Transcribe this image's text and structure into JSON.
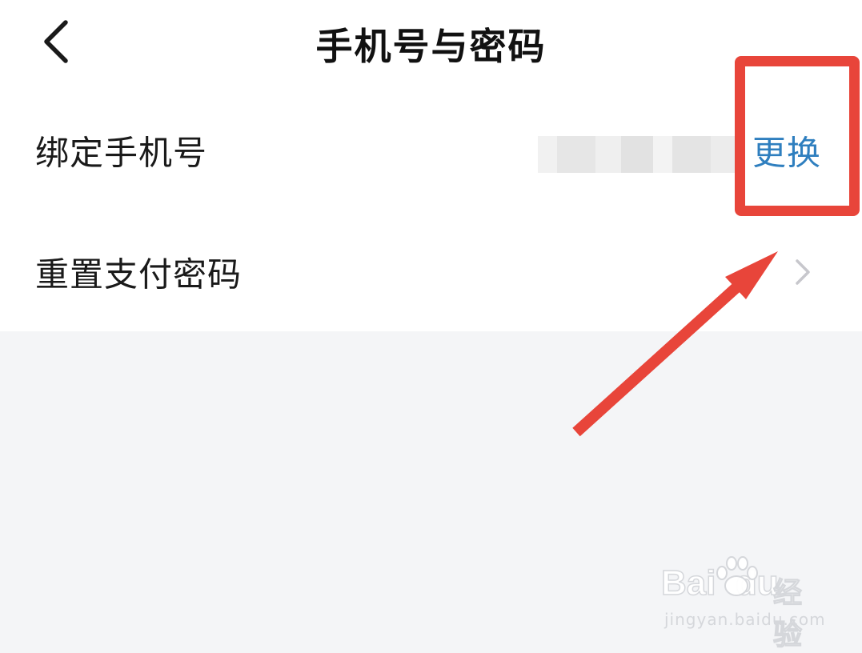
{
  "header": {
    "title": "手机号与密码",
    "back_icon": "chevron-left-icon"
  },
  "rows": [
    {
      "label": "绑定手机号",
      "value": "blurred phone number",
      "action_label": "更换",
      "action_color": "#2f7fbf"
    },
    {
      "label": "重置支付密码",
      "trailing_icon": "chevron-right-icon"
    }
  ],
  "annotation": {
    "highlight_color": "#e8453a",
    "arrow_color": "#e8453a"
  },
  "watermark": {
    "logo_text": "Baidu经验",
    "url": "jingyan.baidu.com"
  },
  "colors": {
    "page_background": "#f4f5f7",
    "panel_background": "#ffffff",
    "text_primary": "#1a1a1a",
    "chevron": "#c7c7cc"
  }
}
